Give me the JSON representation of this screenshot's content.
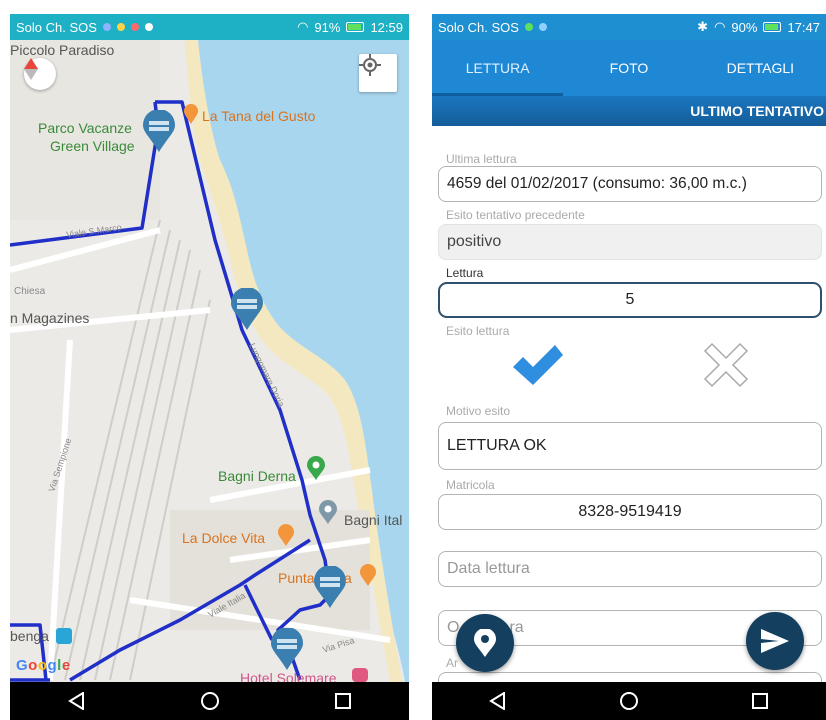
{
  "left": {
    "status": {
      "carrier": "Solo Ch. SOS",
      "battery": "91%",
      "time": "12:59"
    },
    "map": {
      "labels": {
        "piccolo": "Piccolo Paradiso",
        "parco1": "Parco Vacanze",
        "parco2": "Green Village",
        "tana": "La Tana del Gusto",
        "viale_marco": "Viale S.Marco",
        "chiesa": "Chiesa",
        "magazines": "n Magazines",
        "lungomare": "Lungomare Doria",
        "sempione": "Via Sempione",
        "derna": "Bagni Derna",
        "italia": "Bagni Ital",
        "dolce": "La Dolce Vita",
        "punta": "Punta",
        "punta2": "a",
        "pisa": "Via Pisa",
        "viale_italia": "Viale Italia",
        "benga": "benga",
        "hotel": "Hotel Solemare"
      },
      "logo": "Google"
    }
  },
  "right": {
    "status": {
      "carrier": "Solo Ch. SOS",
      "battery": "90%",
      "time": "17:47"
    },
    "tabs": [
      "LETTURA",
      "FOTO",
      "DETTAGLI"
    ],
    "section": "ULTIMO TENTATIVO",
    "form": {
      "ultima_lettura": {
        "label": "Ultima lettura",
        "value": "4659 del 01/02/2017 (consumo: 36,00 m.c.)"
      },
      "esito_precedente": {
        "label": "Esito tentativo precedente",
        "value": "positivo"
      },
      "lettura": {
        "label": "Lettura",
        "value": "5"
      },
      "esito_lettura": {
        "label": "Esito lettura"
      },
      "motivo": {
        "label": "Motivo esito",
        "value": "LETTURA OK"
      },
      "matricola": {
        "label": "Matricola",
        "value": "8328-9519419"
      },
      "data_lettura": {
        "placeholder": "Data lettura"
      },
      "ora_lettura": {
        "placeholder_start": "O",
        "placeholder_end": "ra"
      },
      "partial_label": "Ar"
    }
  },
  "colors": {
    "map_route": "#1f2fc8",
    "accent": "#1e88d4",
    "fab": "#143f5e",
    "check": "#2f8ee0"
  },
  "icons": [
    "compass-icon",
    "locate-icon",
    "map-marker-icon",
    "check-icon",
    "cross-icon",
    "location-pin-icon",
    "send-icon",
    "back-icon",
    "home-icon",
    "recents-icon"
  ]
}
